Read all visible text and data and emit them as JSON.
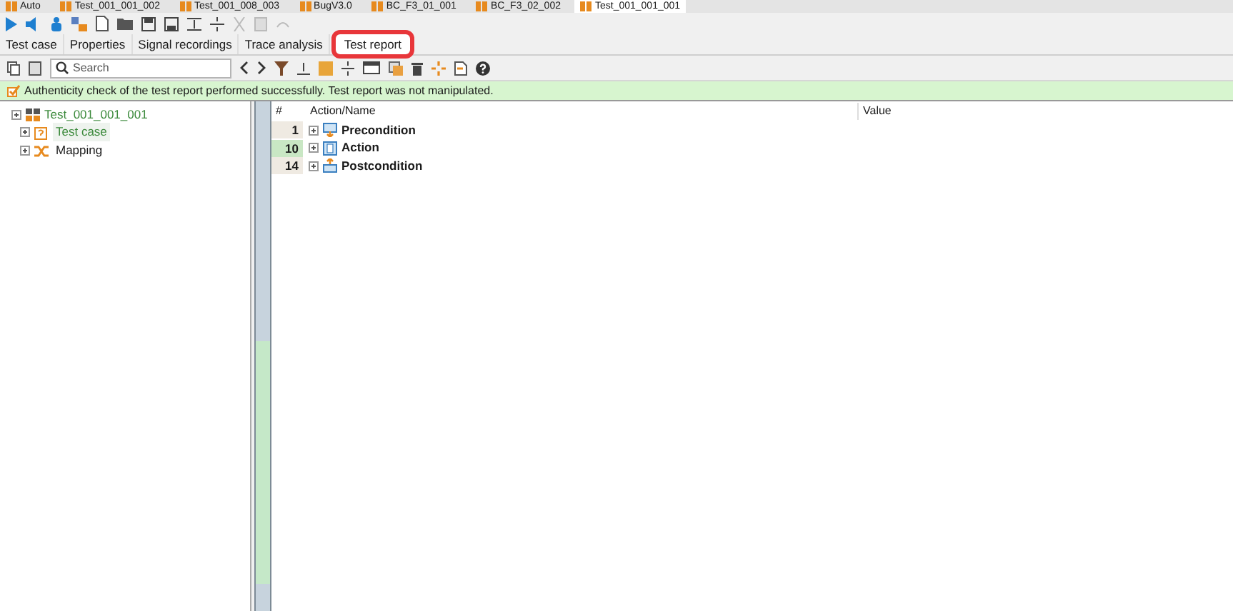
{
  "document_tabs": [
    {
      "label": "Auto",
      "selected": false
    },
    {
      "label": "Test_001_001_002",
      "selected": false
    },
    {
      "label": "Test_001_008_003",
      "selected": false
    },
    {
      "label": "BugV3.0",
      "selected": false
    },
    {
      "label": "BC_F3_01_001",
      "selected": false
    },
    {
      "label": "BC_F3_02_002",
      "selected": false
    },
    {
      "label": "Test_001_001_001",
      "selected": true
    }
  ],
  "view_tabs": [
    {
      "label": "Test case",
      "selected": false
    },
    {
      "label": "Properties",
      "selected": false
    },
    {
      "label": "Signal recordings",
      "selected": false
    },
    {
      "label": "Trace analysis",
      "selected": false
    },
    {
      "label": "Test report",
      "selected": true
    }
  ],
  "search": {
    "placeholder": "Search"
  },
  "banner": "Authenticity check of the test report performed successfully. Test report was not manipulated.",
  "tree": {
    "label": "Test_001_001_001",
    "children": [
      {
        "label": "Test case",
        "selected": true,
        "kind": "testcase"
      },
      {
        "label": "Mapping",
        "selected": false,
        "kind": "mapping"
      }
    ]
  },
  "table": {
    "columns": [
      "#",
      "Action/Name",
      "Value"
    ],
    "rows": [
      {
        "number": "1",
        "name": "Precondition",
        "selected": false,
        "kind": "pre"
      },
      {
        "number": "10",
        "name": "Action",
        "selected": true,
        "kind": "action"
      },
      {
        "number": "14",
        "name": "Postcondition",
        "selected": false,
        "kind": "post"
      }
    ]
  }
}
